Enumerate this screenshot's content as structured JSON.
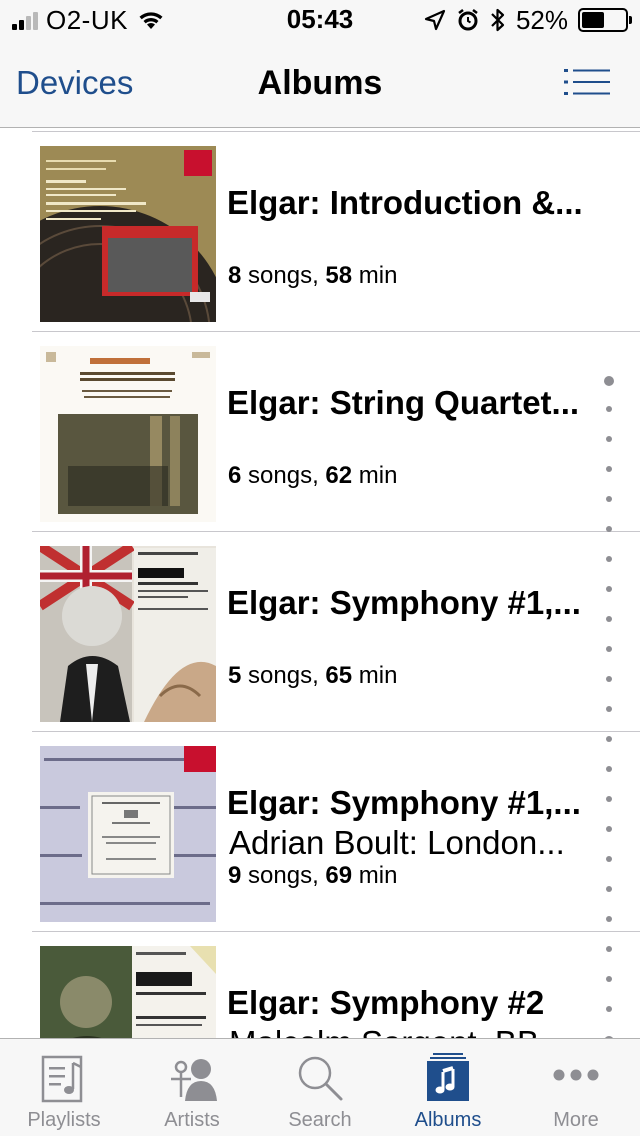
{
  "status_bar": {
    "carrier": "O2-UK",
    "time": "05:43",
    "battery_percent": "52%",
    "battery_level": 0.52,
    "signal_bars": 2,
    "icons": [
      "signal-icon",
      "wifi-icon",
      "location-icon",
      "alarm-icon",
      "bluetooth-icon",
      "battery-icon"
    ]
  },
  "nav": {
    "back_label": "Devices",
    "title": "Albums",
    "menu_icon": "list-icon"
  },
  "albums": [
    {
      "title": "Elgar: Introduction &...",
      "artist": "",
      "songs": "8",
      "songs_label": "songs,",
      "minutes": "58",
      "minutes_label": "min"
    },
    {
      "title": "Elgar: String Quartet...",
      "artist": "",
      "songs": "6",
      "songs_label": "songs,",
      "minutes": "62",
      "minutes_label": "min"
    },
    {
      "title": "Elgar: Symphony #1,...",
      "artist": "",
      "songs": "5",
      "songs_label": "songs,",
      "minutes": "65",
      "minutes_label": "min"
    },
    {
      "title": "Elgar: Symphony #1,...",
      "artist": "Adrian Boult: London...",
      "songs": "9",
      "songs_label": "songs,",
      "minutes": "69",
      "minutes_label": "min"
    },
    {
      "title": "Elgar: Symphony #2",
      "artist": "Malcolm Sargent, BB...",
      "songs": "",
      "songs_label": "",
      "minutes": "",
      "minutes_label": ""
    }
  ],
  "tabs": [
    {
      "label": "Playlists",
      "icon": "playlist-icon",
      "active": false
    },
    {
      "label": "Artists",
      "icon": "artist-icon",
      "active": false
    },
    {
      "label": "Search",
      "icon": "search-icon",
      "active": false
    },
    {
      "label": "Albums",
      "icon": "album-icon",
      "active": true
    },
    {
      "label": "More",
      "icon": "more-icon",
      "active": false
    }
  ],
  "colors": {
    "accent": "#1f4e8c",
    "inactive": "#8e8e93",
    "bar_background": "#f7f7f7",
    "separator": "#c8c7cc"
  }
}
